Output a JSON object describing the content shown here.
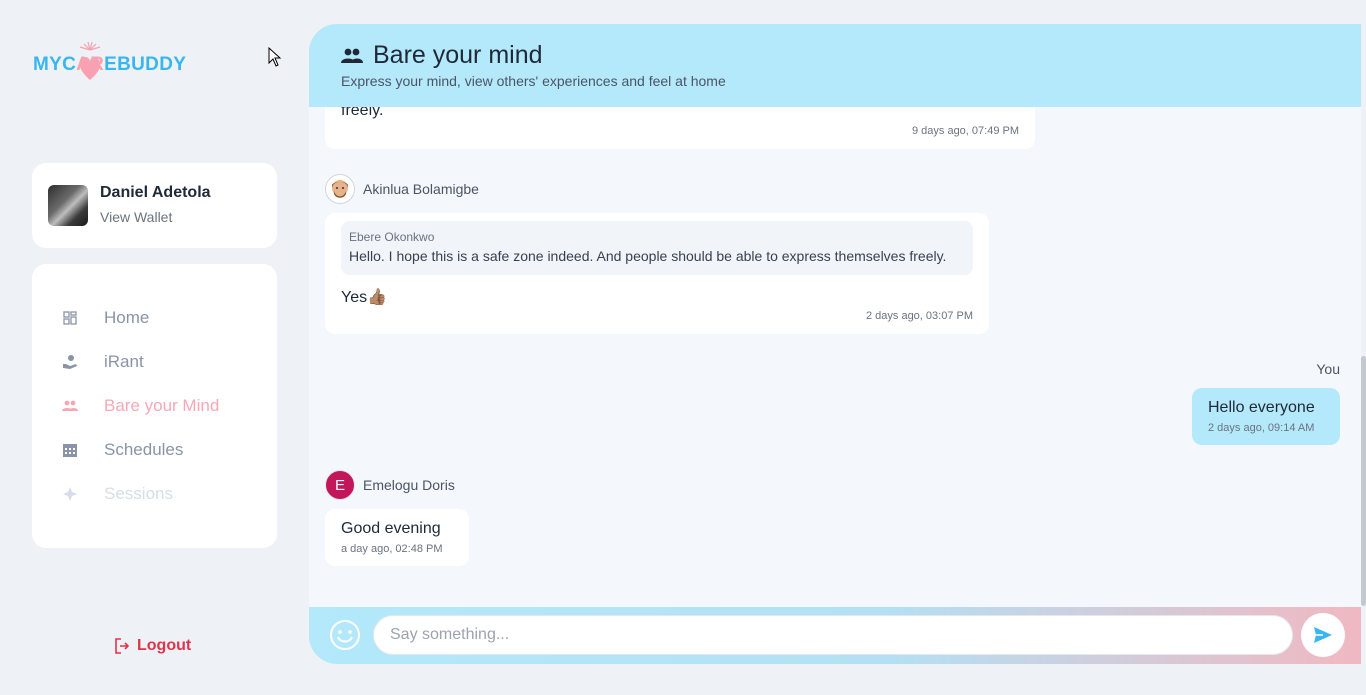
{
  "brand": {
    "logo_part1": "MYC",
    "logo_part2": "AR",
    "logo_part3": "EBUDDY",
    "primary_color": "#38b6f0",
    "accent_color": "#f7a1b3"
  },
  "profile": {
    "name": "Daniel Adetola",
    "link": "View Wallet"
  },
  "nav": {
    "items": [
      {
        "label": "Home",
        "icon": "grid-icon"
      },
      {
        "label": "iRant",
        "icon": "hand-person-icon"
      },
      {
        "label": "Bare your Mind",
        "icon": "people-icon"
      },
      {
        "label": "Schedules",
        "icon": "calendar-icon"
      },
      {
        "label": "Sessions",
        "icon": "sessions-icon"
      }
    ],
    "active_index": 2
  },
  "logout_label": "Logout",
  "header": {
    "title": "Bare your mind",
    "subtitle": "Express your mind, view others' experiences and feel at home"
  },
  "messages": {
    "m0": {
      "text_fragment": "freely.",
      "time": "9 days ago, 07:49 PM"
    },
    "m1": {
      "sender": "Akinlua Bolamigbe",
      "quote_author": "Ebere Okonkwo",
      "quote_text": "Hello. I hope this is a safe zone indeed. And people should be able to express themselves freely.",
      "text": "Yes👍🏽",
      "time": "2 days ago, 03:07 PM"
    },
    "m2": {
      "sender": "You",
      "text": "Hello everyone",
      "time": "2 days ago, 09:14 AM"
    },
    "m3": {
      "sender": "Emelogu Doris",
      "avatar_letter": "E",
      "text": "Good evening",
      "time": "a day ago, 02:48 PM"
    }
  },
  "composer": {
    "placeholder": "Say something...",
    "value": ""
  }
}
